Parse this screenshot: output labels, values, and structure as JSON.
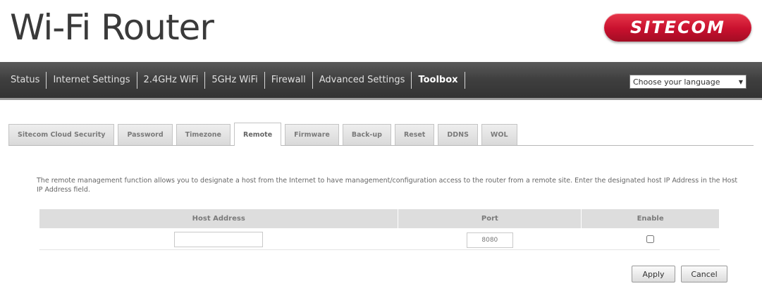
{
  "header": {
    "title": "Wi-Fi Router",
    "brand": "SITECOM",
    "brand_color": "#c8102e"
  },
  "nav": {
    "items": [
      {
        "label": "Status",
        "active": false
      },
      {
        "label": "Internet Settings",
        "active": false
      },
      {
        "label": "2.4GHz WiFi",
        "active": false
      },
      {
        "label": "5GHz WiFi",
        "active": false
      },
      {
        "label": "Firewall",
        "active": false
      },
      {
        "label": "Advanced Settings",
        "active": false
      },
      {
        "label": "Toolbox",
        "active": true
      }
    ],
    "language_select": {
      "value": "Choose your language",
      "icon": "dropdown-arrow-icon"
    }
  },
  "tabs": [
    {
      "label": "Sitecom Cloud Security",
      "active": false
    },
    {
      "label": "Password",
      "active": false
    },
    {
      "label": "Timezone",
      "active": false
    },
    {
      "label": "Remote",
      "active": true
    },
    {
      "label": "Firmware",
      "active": false
    },
    {
      "label": "Back-up",
      "active": false
    },
    {
      "label": "Reset",
      "active": false
    },
    {
      "label": "DDNS",
      "active": false
    },
    {
      "label": "WOL",
      "active": false
    }
  ],
  "remote": {
    "description": "The remote management function allows you to designate a host from the Internet to have management/configuration access to the router from a remote site. Enter the designated host IP Address in the Host IP Address field.",
    "table": {
      "headers": [
        "Host Address",
        "Port",
        "Enable"
      ],
      "host_value": "",
      "port_placeholder": "8080",
      "enabled": false
    },
    "apply_label": "Apply",
    "cancel_label": "Cancel"
  }
}
